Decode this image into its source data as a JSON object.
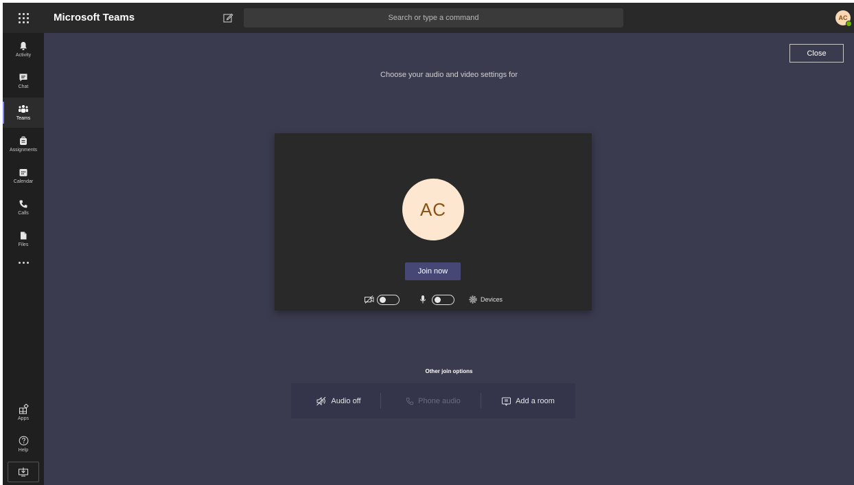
{
  "app": {
    "name": "Microsoft Teams"
  },
  "search": {
    "placeholder": "Search or type a command"
  },
  "user": {
    "initials": "AC",
    "presence_color": "#6bb700"
  },
  "rail": {
    "items": [
      {
        "label": "Activity",
        "icon": "bell-icon"
      },
      {
        "label": "Chat",
        "icon": "chat-icon"
      },
      {
        "label": "Teams",
        "icon": "teams-icon",
        "active": true
      },
      {
        "label": "Assignments",
        "icon": "assignments-icon"
      },
      {
        "label": "Calendar",
        "icon": "calendar-icon"
      },
      {
        "label": "Calls",
        "icon": "phone-icon"
      },
      {
        "label": "Files",
        "icon": "file-icon"
      }
    ],
    "bottom": [
      {
        "label": "Apps",
        "icon": "apps-icon"
      },
      {
        "label": "Help",
        "icon": "help-icon"
      }
    ]
  },
  "prejoin": {
    "close_label": "Close",
    "prompt": "Choose your audio and video settings for",
    "avatar_initials": "AC",
    "join_label": "Join now",
    "camera_on": false,
    "mic_on": false,
    "devices_label": "Devices"
  },
  "other_options": {
    "title": "Other join options",
    "audio_off": "Audio off",
    "phone_audio": "Phone audio",
    "add_room": "Add a room"
  },
  "colors": {
    "accent": "#464775",
    "stage": "#3b3b4f",
    "preview_bg": "#292929",
    "avatar_bg": "#fde7d0"
  }
}
